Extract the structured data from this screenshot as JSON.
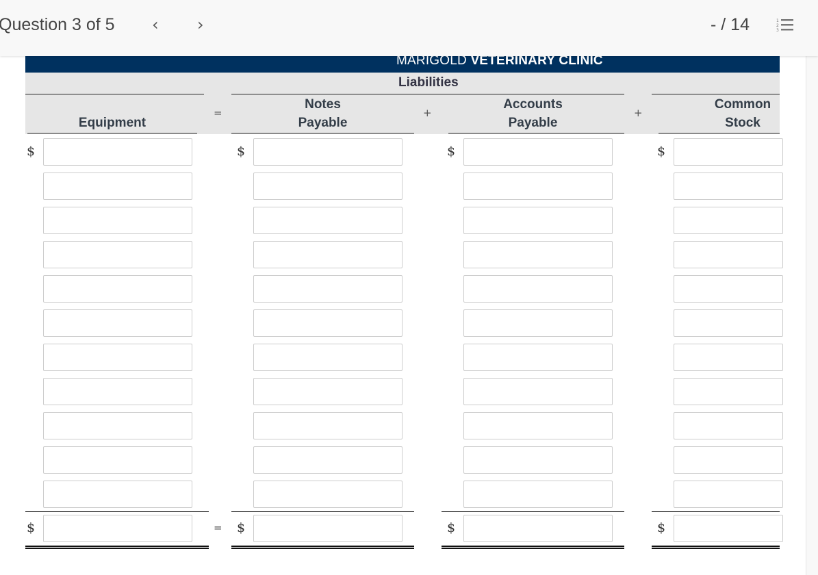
{
  "topbar": {
    "question_label": "Question 3 of 5",
    "prev_icon": "‹",
    "next_icon": "›",
    "score": "- / 14",
    "list_icon": "numbered-list-icon"
  },
  "sheet": {
    "company_prefix": "MARIGOLD",
    "company_suffix": "VETERINARY CLINIC",
    "group_label": "Liabilities",
    "columns": [
      {
        "line1": "",
        "line2": "Equipment"
      },
      {
        "line1": "Notes",
        "line2": "Payable"
      },
      {
        "line1": "Accounts",
        "line2": "Payable"
      },
      {
        "line1": "Common",
        "line2": "Stock"
      }
    ],
    "operators": [
      "=",
      "+",
      "+"
    ],
    "currency_symbol": "$",
    "total_operator": "=",
    "row_count": 11,
    "values": [
      [
        "",
        "",
        "",
        ""
      ],
      [
        "",
        "",
        "",
        ""
      ],
      [
        "",
        "",
        "",
        ""
      ],
      [
        "",
        "",
        "",
        ""
      ],
      [
        "",
        "",
        "",
        ""
      ],
      [
        "",
        "",
        "",
        ""
      ],
      [
        "",
        "",
        "",
        ""
      ],
      [
        "",
        "",
        "",
        ""
      ],
      [
        "",
        "",
        "",
        ""
      ],
      [
        "",
        "",
        "",
        ""
      ],
      [
        "",
        "",
        "",
        ""
      ]
    ],
    "totals": [
      "",
      "",
      "",
      ""
    ]
  }
}
